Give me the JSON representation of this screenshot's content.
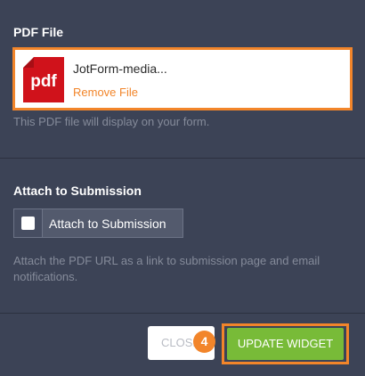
{
  "pdf_section": {
    "title": "PDF File",
    "file_icon_text": "pdf",
    "file_name": "JotForm-media...",
    "remove_label": "Remove File",
    "help_text": "This PDF file will display on your form."
  },
  "attach_section": {
    "title": "Attach to Submission",
    "checkbox_label": "Attach to Submission",
    "checkbox_checked": false,
    "help_text": "Attach the PDF URL as a link to submission page and email notifications."
  },
  "footer": {
    "close_label": "CLOSE",
    "step_number": "4",
    "update_label": "UPDATE WIDGET"
  },
  "colors": {
    "background": "#3c4356",
    "highlight": "#f2852a",
    "update_button": "#78bb38",
    "pdf_icon": "#d0121b"
  }
}
